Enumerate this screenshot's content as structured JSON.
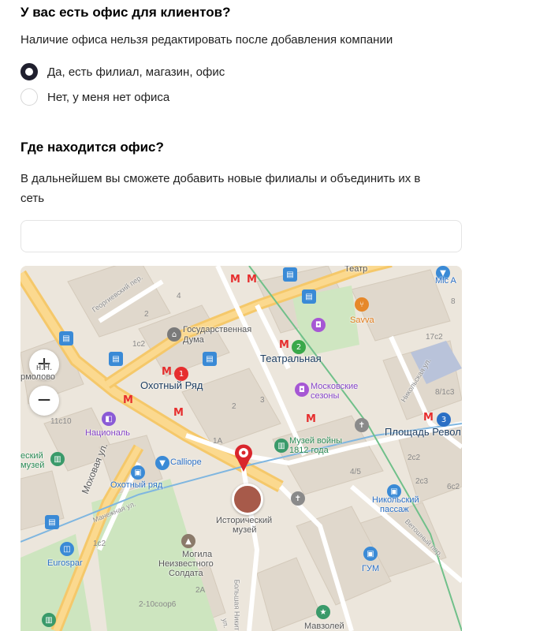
{
  "office_question": {
    "title": "У вас есть офис для клиентов?",
    "note": "Наличие офиса нельзя редактировать после добавления компании",
    "options": [
      {
        "label": "Да, есть филиал, магазин, офис",
        "selected": true
      },
      {
        "label": "Нет, у меня нет офиса",
        "selected": false
      }
    ]
  },
  "location": {
    "title": "Где находится офис?",
    "note_line1": "В дальнейшем вы сможете добавить новые филиалы и объединить их в",
    "note_line2": "сеть",
    "address_value": "",
    "address_placeholder": ""
  },
  "map": {
    "zoom_in": "+",
    "zoom_out": "−",
    "places": {
      "okhotny_ryad": "Охотный Ряд",
      "teatralnaya": "Театральная",
      "ploshchad_rev": "Площадь Револ",
      "gos_duma_1": "Государственная",
      "gos_duma_2": "Дума",
      "moskovskie_1": "Московские",
      "moskovskie_2": "сезоны",
      "muzey_voyny_1": "Музей войны",
      "muzey_voyny_2": "1812 года",
      "savva": "Savva",
      "calliope": "Calliope",
      "okhotny_ryad_mall": "Охотный ряд",
      "nikolsky_1": "Никольский",
      "nikolsky_2": "пассаж",
      "istorichesky_1": "Исторический",
      "istorichesky_2": "музей",
      "mogila_1": "Могила",
      "mogila_2": "Неизвестного",
      "mogila_3": "Солдата",
      "gum": "ГУМ",
      "mavzoley": "Мавзолей",
      "natsional": "Националь",
      "eurospar": "Eurospar",
      "mlc": "Mlc A",
      "teatr": "Театр",
      "eskiy": "еский",
      "muzey_left": "музей",
      "hn_1": "н.Н.",
      "hn_2": "рмолово"
    },
    "streets": {
      "mokhovaya": "Моховая ул.",
      "manezhnaya": "Манежная ул.",
      "georgievsky": "Георгиевский пер.",
      "nikolskaya": "Никольская ул.",
      "vetoshny": "Ветошный пер.",
      "bolshaya": "Большая Никит",
      "ul_short": "ул."
    },
    "numbers": {
      "n2a": "2",
      "n4": "4",
      "n1c2": "1c2",
      "n11c10": "11c10",
      "n2b": "2",
      "n3": "3",
      "n1a": "1A",
      "n4_5": "4/5",
      "n17c2": "17c2",
      "n8": "8",
      "n8_1c3": "8/1c3",
      "n2c2": "2c2",
      "n2c3": "2c3",
      "n6c2": "6c2",
      "n1c2b": "1c2",
      "n2A": "2A",
      "n2_10": "2-10соор6"
    },
    "metro_lines": {
      "red": "1",
      "green": "2",
      "blue": "3"
    },
    "colors": {
      "metro": "#e62e2e",
      "primary_radio": "#1f1f2e",
      "pin": "#d9262c"
    }
  }
}
